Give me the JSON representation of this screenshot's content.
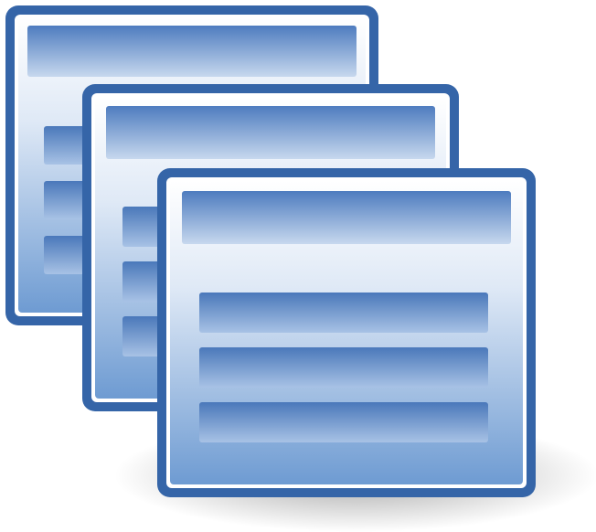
{
  "icon": {
    "name": "window-stack-icon",
    "windows": [
      {
        "name": "back-window"
      },
      {
        "name": "middle-window"
      },
      {
        "name": "front-window"
      }
    ]
  },
  "colors": {
    "frame": "#3565a8",
    "frame_light": "#ffffff",
    "titlebar_top": "#5a86c4",
    "titlebar_bottom": "#c9d9ee",
    "body_top": "#ffffff",
    "body_bottom": "#6e9bd2",
    "row_top": "#4f7dbd",
    "row_bottom": "#a9c3e6",
    "shadow": "#000000"
  }
}
